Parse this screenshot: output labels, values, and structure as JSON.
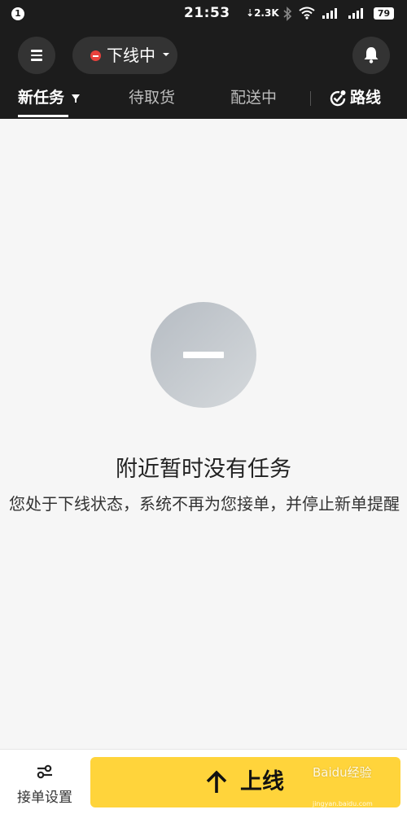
{
  "status_bar": {
    "notification_count": "1",
    "time": "21:53",
    "net_speed": "2.3K",
    "battery": "79",
    "icons": [
      "bluetooth-icon",
      "wifi-icon",
      "signal-icon",
      "signal-icon"
    ]
  },
  "header": {
    "status_label": "下线中",
    "status_color": "#e8413c",
    "tabs": [
      {
        "label": "新任务",
        "active": true
      },
      {
        "label": "待取货",
        "active": false
      },
      {
        "label": "配送中",
        "active": false
      }
    ],
    "route_label": "路线"
  },
  "empty_state": {
    "title": "附近暂时没有任务",
    "description": "您处于下线状态，系统不再为您接单，并停止新单提醒"
  },
  "bottom": {
    "settings_label": "接单设置",
    "online_label": "上线",
    "accent_color": "#ffd43b"
  },
  "watermark": {
    "text": "Baidu经验",
    "url": "jingyan.baidu.com"
  }
}
